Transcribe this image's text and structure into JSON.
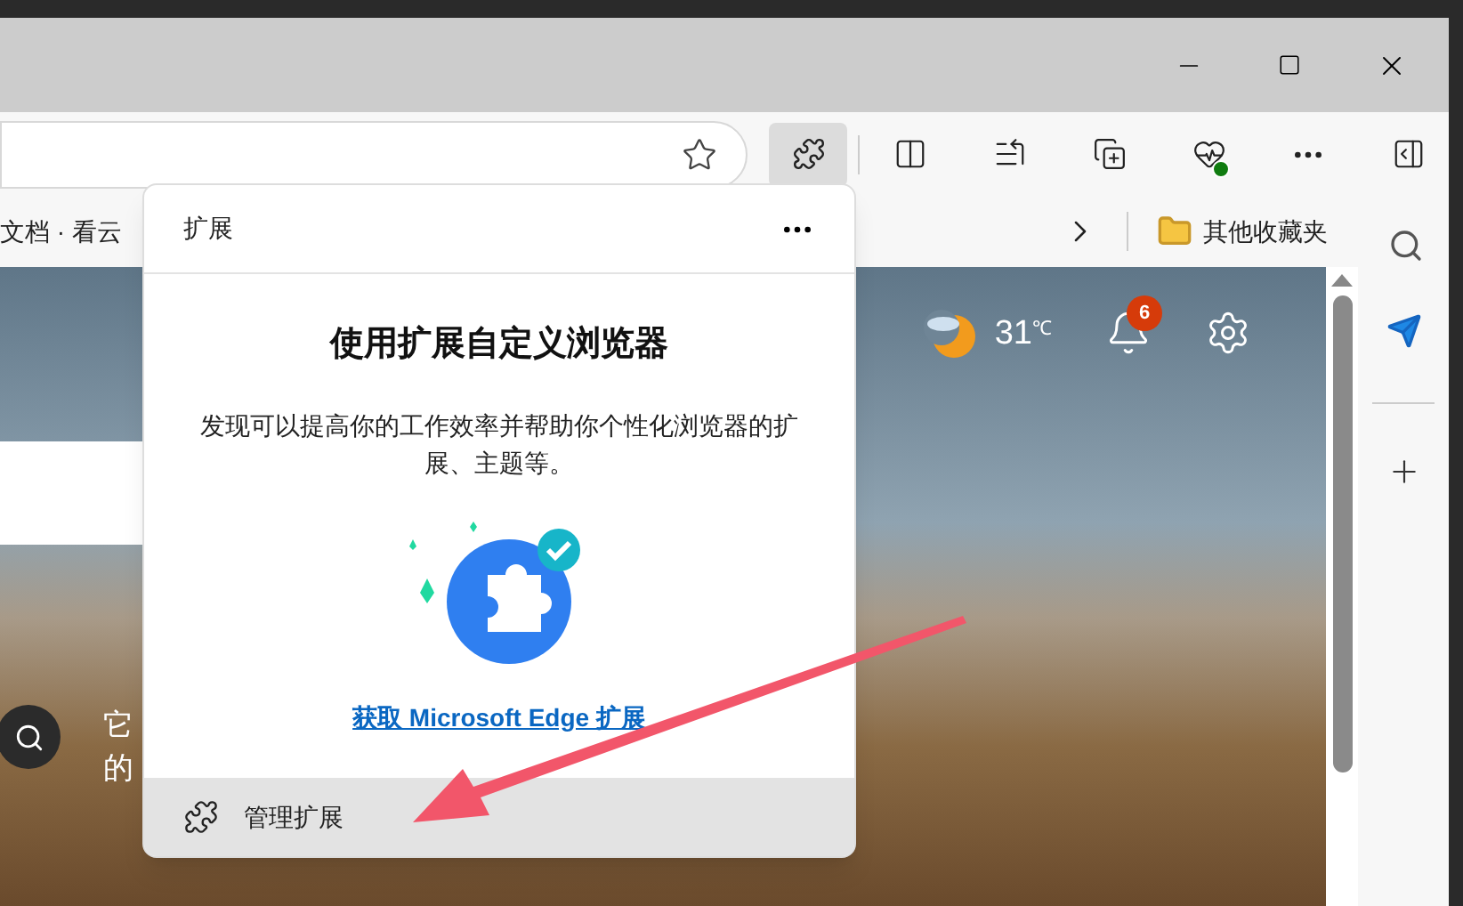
{
  "favorites_bar": {
    "bookmark": "文档 · 看云",
    "other_folder": "其他收藏夹"
  },
  "page": {
    "temperature": "31",
    "unit": "℃",
    "notification_count": "6",
    "snippet_lines": [
      "它",
      "的"
    ]
  },
  "extensions_popup": {
    "title": "扩展",
    "heading": "使用扩展自定义浏览器",
    "description": "发现可以提高你的工作效率并帮助你个性化浏览器的扩展、主题等。",
    "link": "获取 Microsoft Edge 扩展",
    "manage": "管理扩展"
  }
}
